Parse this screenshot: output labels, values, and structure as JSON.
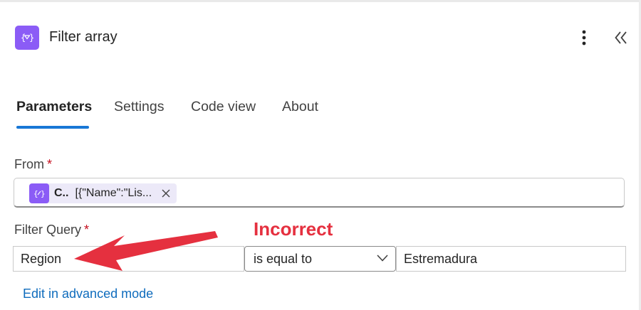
{
  "header": {
    "title": "Filter array",
    "icon": "filter-array-icon",
    "accent": "#8b5cf6"
  },
  "tabs": [
    {
      "label": "Parameters",
      "active": true
    },
    {
      "label": "Settings",
      "active": false
    },
    {
      "label": "Code view",
      "active": false
    },
    {
      "label": "About",
      "active": false
    }
  ],
  "from": {
    "label": "From",
    "required_mark": "*",
    "token": {
      "name": "C..",
      "value": "[{\"Name\":\"Lis...",
      "icon": "expression-icon"
    }
  },
  "filter_query": {
    "label": "Filter Query",
    "required_mark": "*",
    "left_value": "Region",
    "operator": "is equal to",
    "right_value": "Estremadura"
  },
  "annotation": {
    "text": "Incorrect",
    "color": "#e5303f"
  },
  "advanced_link": "Edit in advanced mode",
  "colors": {
    "active_tab_underline": "#1877d6",
    "link": "#0f6cbd",
    "required": "#c50f1f"
  }
}
